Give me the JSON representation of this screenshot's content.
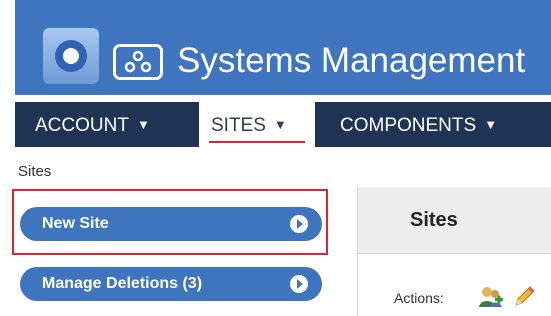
{
  "header": {
    "app_title": "Systems Management",
    "logo_icon": "target-logo-icon",
    "app_icon": "network-nodes-icon"
  },
  "nav": {
    "items": [
      {
        "label": "ACCOUNT",
        "active": false
      },
      {
        "label": "SITES",
        "active": true
      },
      {
        "label": "COMPONENTS",
        "active": false
      }
    ]
  },
  "breadcrumb": "Sites",
  "sidebar": {
    "buttons": [
      {
        "label": "New Site",
        "highlighted": true
      },
      {
        "label": "Manage Deletions (3)",
        "highlighted": false
      }
    ]
  },
  "panel": {
    "title": "Sites",
    "actions_label": "Actions:",
    "action_icons": [
      "add-users-icon",
      "edit-pencil-icon"
    ]
  },
  "colors": {
    "brand_blue": "#3f74bf",
    "nav_dark": "#1f3454",
    "highlight_red": "#e0262c"
  }
}
